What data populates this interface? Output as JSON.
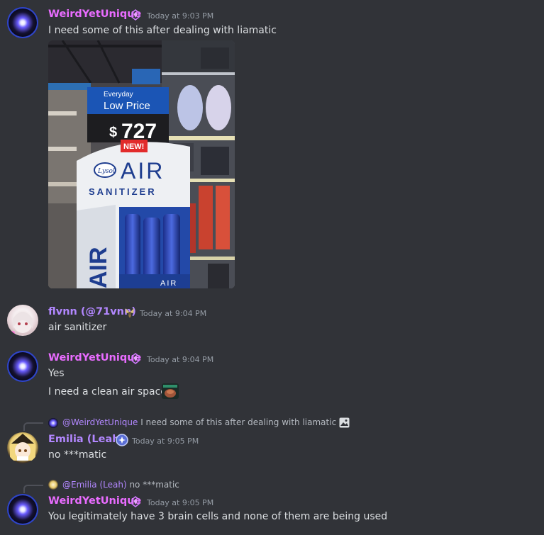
{
  "messages": [
    {
      "author": "WeirdYetUnique",
      "timestamp": "Today at 9:03 PM",
      "lines": [
        "I need some of this after dealing with liamatic"
      ],
      "image": {
        "sign_top": "Everyday",
        "sign_bottom": "Low Price",
        "price_symbol": "$",
        "price": "727",
        "new_tag": "NEW!",
        "brand": "Lysol",
        "product_word": "AIR",
        "product_sub": "SANITIZER",
        "side_word": "AIR",
        "bottle_word": "AIR"
      }
    },
    {
      "author": "flvnn (@71vnn)",
      "timestamp": "Today at 9:04 PM",
      "lines": [
        "air sanitizer"
      ]
    },
    {
      "author": "WeirdYetUnique",
      "timestamp": "Today at 9:04 PM",
      "lines": [
        "Yes",
        "I need a clean air space"
      ]
    },
    {
      "reply_to_name": "@WeirdYetUnique",
      "reply_to_text": "I need some of this after dealing with liamatic",
      "author": "Emilia (Leah)",
      "timestamp": "Today at 9:05 PM",
      "lines": [
        "no ***matic"
      ]
    },
    {
      "reply_to_name": "@Emilia (Leah)",
      "reply_to_text": "no ***matic",
      "author": "WeirdYetUnique",
      "timestamp": "Today at 9:05 PM",
      "lines": [
        "You legitimately have 3 brain cells and none of them are being used"
      ]
    }
  ],
  "colors": {
    "background": "#313338",
    "username_pink": "#e96cff",
    "username_purple": "#b287ff",
    "timestamp": "#949ba4",
    "text": "#dbdee1"
  }
}
